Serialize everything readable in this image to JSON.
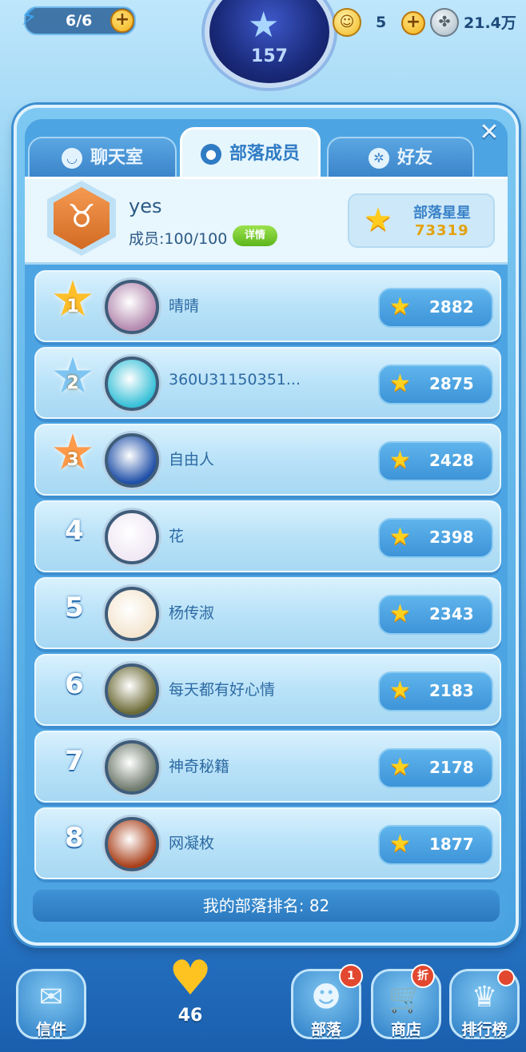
{
  "hud": {
    "energy_icon": "lightning-icon",
    "energy": "6/6",
    "level": "157",
    "coins": "5",
    "clovers": "21.4万"
  },
  "tabs": [
    {
      "label": "聊天室",
      "icon": "chat-icon",
      "active": false
    },
    {
      "label": "部落成员",
      "icon": "members-icon",
      "active": true
    },
    {
      "label": "好友",
      "icon": "friends-icon",
      "active": false
    }
  ],
  "tribe": {
    "name": "yes",
    "members_label": "成员:100/100",
    "detail_label": "详情",
    "stars_label": "部落星星",
    "stars_value": "73319",
    "badge_glyph": "♉"
  },
  "members": [
    {
      "rank": "1",
      "name": "晴晴",
      "score": "2882",
      "medal": "gold",
      "avatar_color": "#b58bb0"
    },
    {
      "rank": "2",
      "name": "360U31150351...",
      "score": "2875",
      "medal": "silver",
      "avatar_color": "#38c0d8"
    },
    {
      "rank": "3",
      "name": "自由人",
      "score": "2428",
      "medal": "bronze",
      "avatar_color": "#1f4fa8"
    },
    {
      "rank": "4",
      "name": "花",
      "score": "2398",
      "medal": "",
      "avatar_color": "#f0e8f4"
    },
    {
      "rank": "5",
      "name": "杨传淑",
      "score": "2343",
      "medal": "",
      "avatar_color": "#f4e6d0"
    },
    {
      "rank": "6",
      "name": "每天都有好心情",
      "score": "2183",
      "medal": "",
      "avatar_color": "#6b6a36"
    },
    {
      "rank": "7",
      "name": "神奇秘籍",
      "score": "2178",
      "medal": "",
      "avatar_color": "#6f7a6c"
    },
    {
      "rank": "8",
      "name": "网凝枚",
      "score": "1877",
      "medal": "",
      "avatar_color": "#a9401a"
    }
  ],
  "my_rank": "我的部落排名: 82",
  "bottom": {
    "mail_label": "信件",
    "hearts": "46",
    "tribe_label": "部落",
    "tribe_badge": "1",
    "shop_label": "商店",
    "shop_badge": "折",
    "ranking_label": "排行榜"
  },
  "colors": {
    "panel": "#4da4e2",
    "row": "#b9e2f8",
    "star": "#ffd21f",
    "accent_text": "#2d6aa3"
  }
}
